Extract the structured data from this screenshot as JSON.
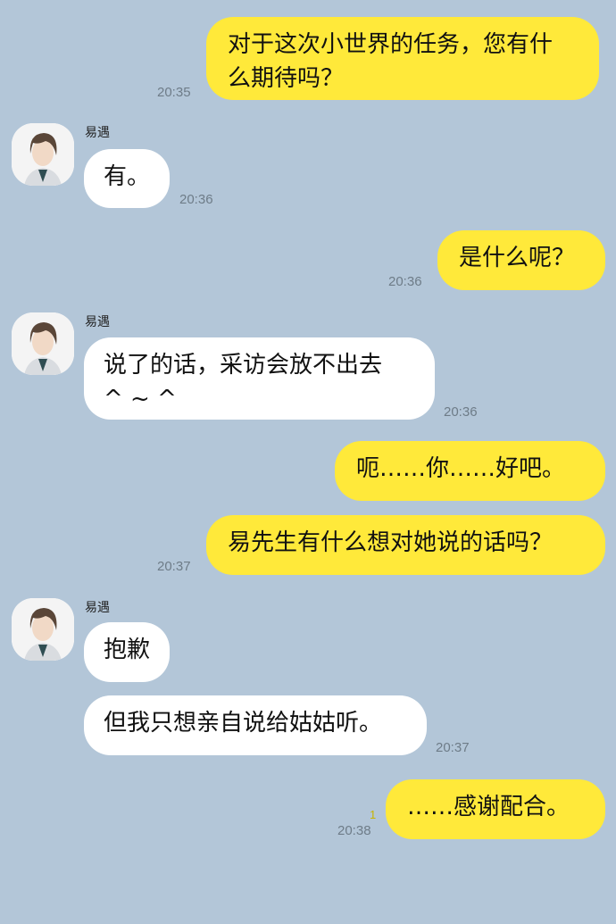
{
  "chat": {
    "contact_name": "易遇",
    "messages": [
      {
        "sender": "me",
        "text": "对于这次小世界的任务，您有什\n么期待吗？",
        "time": "20:35"
      },
      {
        "sender": "other",
        "text": "有。",
        "time": "20:36"
      },
      {
        "sender": "me",
        "text": "是什么呢？",
        "time": "20:36"
      },
      {
        "sender": "other",
        "text": "说了的话，采访会放不出去\n^ ~ ^",
        "time": "20:36"
      },
      {
        "sender": "me",
        "text": "呃……你……好吧。",
        "time": ""
      },
      {
        "sender": "me",
        "text": "易先生有什么想对她说的话吗？",
        "time": "20:37"
      },
      {
        "sender": "other",
        "text": "抱歉",
        "time": ""
      },
      {
        "sender": "other",
        "text": "但我只想亲自说给姑姑听。",
        "time": "20:37"
      },
      {
        "sender": "me",
        "text": "……感谢配合。",
        "time": "20:38",
        "read_count": "1"
      }
    ]
  },
  "colors": {
    "background": "#b3c6d8",
    "my_bubble": "#ffe93a",
    "their_bubble": "#ffffff"
  },
  "icons": {
    "avatar": "contact-avatar-portrait"
  }
}
